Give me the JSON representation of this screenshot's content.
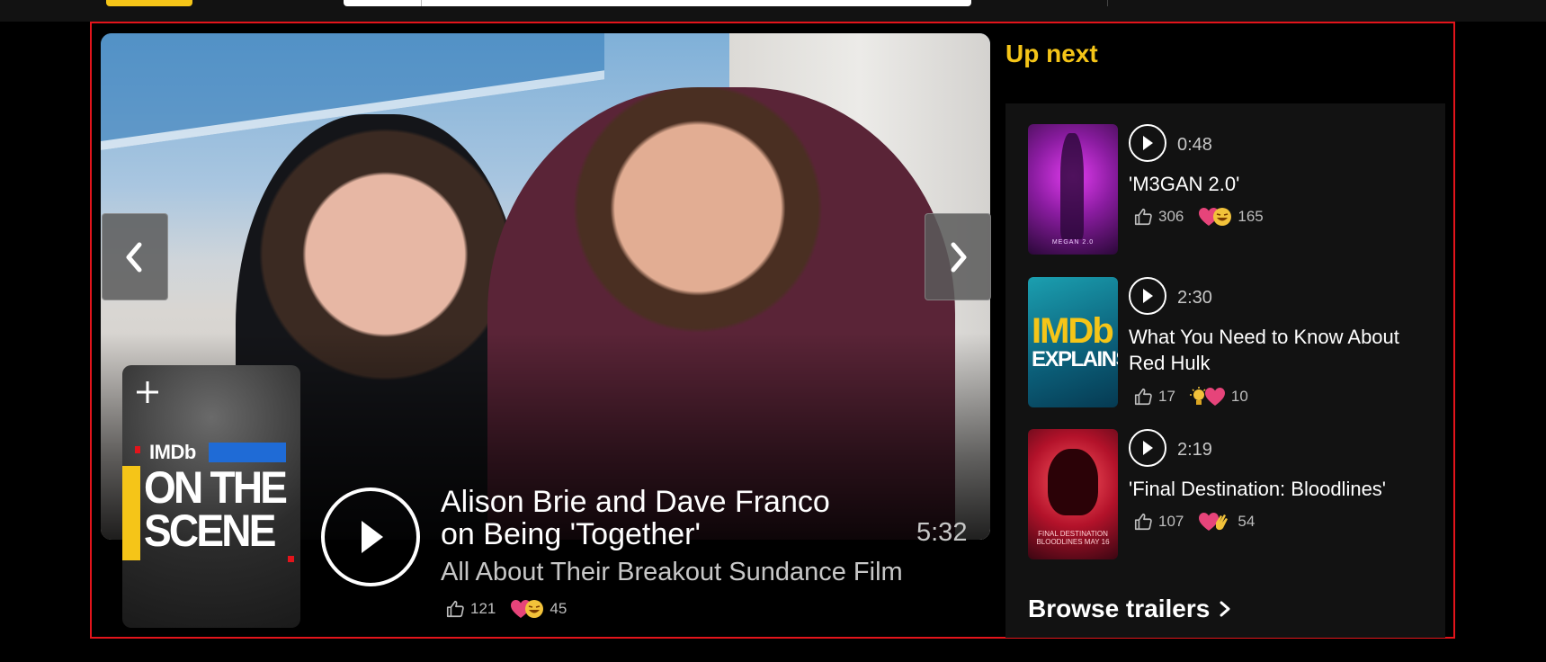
{
  "hero": {
    "title": "Alison Brie and Dave Franco on Being 'Together'",
    "subtitle": "All About Their Breakout Sundance Film",
    "duration": "5:32",
    "likes": "121",
    "reactions": "45",
    "poster": {
      "brand": "IMDb",
      "line1": "ON THE",
      "line2": "SCENE"
    }
  },
  "up_next": {
    "heading": "Up next",
    "items": [
      {
        "duration": "0:48",
        "title": "'M3GAN 2.0'",
        "likes": "306",
        "reactions": "165",
        "thumb_text": "MEGAN 2.0"
      },
      {
        "duration": "2:30",
        "title": "What You Need to Know About Red Hulk",
        "likes": "17",
        "reactions": "10",
        "thumb_line1": "IMDb",
        "thumb_line2": "EXPLAINS"
      },
      {
        "duration": "2:19",
        "title": "'Final Destination: Bloodlines'",
        "likes": "107",
        "reactions": "54",
        "thumb_text": "FINAL DESTINATION BLOODLINES MAY 16"
      }
    ]
  },
  "browse_label": "Browse trailers",
  "colors": {
    "accent": "#f5c518",
    "frame": "#e3141b",
    "heart": "#e6447a",
    "emoji": "#f2c23a"
  },
  "icons": [
    "chevron-left-icon",
    "chevron-right-icon",
    "plus-icon",
    "play-icon",
    "thumbs-up-icon",
    "heart-icon",
    "laugh-emoji-icon",
    "lightbulb-icon",
    "clap-icon",
    "chevron-right-small-icon"
  ]
}
